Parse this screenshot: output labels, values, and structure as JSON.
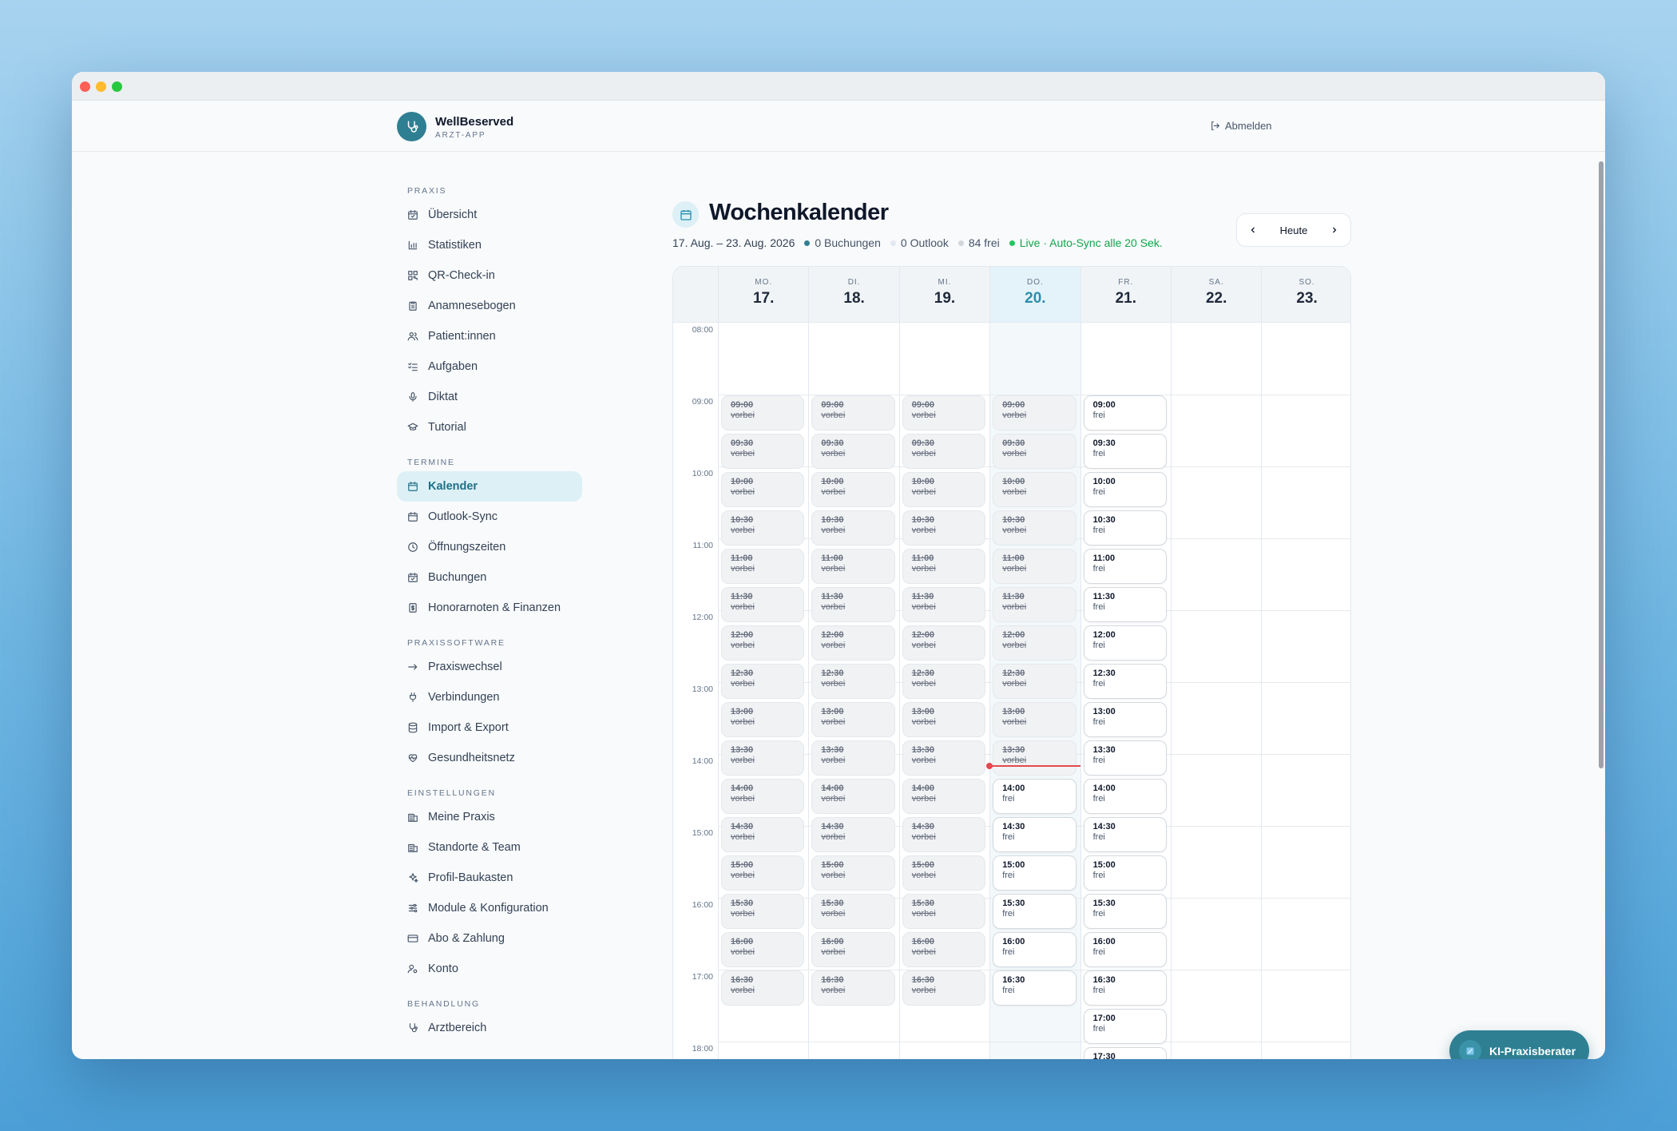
{
  "app": {
    "name": "WellBeserved",
    "subtitle": "ARZT-APP",
    "logout": "Abmelden"
  },
  "sidebar": {
    "sections": [
      {
        "label": "PRAXIS",
        "items": [
          {
            "label": "Übersicht",
            "icon": "calendar-check-icon"
          },
          {
            "label": "Statistiken",
            "icon": "bar-chart-icon"
          },
          {
            "label": "QR-Check-in",
            "icon": "qr-code-icon"
          },
          {
            "label": "Anamnesebogen",
            "icon": "clipboard-icon"
          },
          {
            "label": "Patient:innen",
            "icon": "users-icon"
          },
          {
            "label": "Aufgaben",
            "icon": "checklist-icon"
          },
          {
            "label": "Diktat",
            "icon": "microphone-icon"
          },
          {
            "label": "Tutorial",
            "icon": "graduation-cap-icon"
          }
        ]
      },
      {
        "label": "TERMINE",
        "items": [
          {
            "label": "Kalender",
            "icon": "calendar-icon",
            "active": true
          },
          {
            "label": "Outlook-Sync",
            "icon": "calendar-icon"
          },
          {
            "label": "Öffnungszeiten",
            "icon": "clock-icon"
          },
          {
            "label": "Buchungen",
            "icon": "calendar-check-icon"
          },
          {
            "label": "Honorarnoten & Finanzen",
            "icon": "invoice-icon"
          }
        ]
      },
      {
        "label": "PRAXISSOFTWARE",
        "items": [
          {
            "label": "Praxiswechsel",
            "icon": "arrow-right-icon"
          },
          {
            "label": "Verbindungen",
            "icon": "plug-icon"
          },
          {
            "label": "Import & Export",
            "icon": "database-icon"
          },
          {
            "label": "Gesundheitsnetz",
            "icon": "heart-pulse-icon"
          }
        ]
      },
      {
        "label": "EINSTELLUNGEN",
        "items": [
          {
            "label": "Meine Praxis",
            "icon": "building-icon"
          },
          {
            "label": "Standorte & Team",
            "icon": "building-icon"
          },
          {
            "label": "Profil-Baukasten",
            "icon": "sparkles-icon"
          },
          {
            "label": "Module & Konfiguration",
            "icon": "sliders-icon"
          },
          {
            "label": "Abo & Zahlung",
            "icon": "credit-card-icon"
          },
          {
            "label": "Konto",
            "icon": "user-cog-icon"
          }
        ]
      },
      {
        "label": "BEHANDLUNG",
        "items": [
          {
            "label": "Arztbereich",
            "icon": "stethoscope-icon"
          }
        ]
      }
    ]
  },
  "calendar": {
    "title": "Wochenkalender",
    "range": "17. Aug. – 23. Aug. 2026",
    "stats": {
      "bookings": "0 Buchungen",
      "outlook": "0 Outlook",
      "free": "84 frei",
      "live": "Live · Auto-Sync alle 20 Sek."
    },
    "colors": {
      "bookings": "#2f7f93",
      "outlook": "#e2e8f0",
      "free": "#e5e7eb",
      "live": "#16a34a",
      "now": "#e5484d"
    },
    "today_label": "Heute",
    "days": [
      {
        "wd": "MO.",
        "dn": "17."
      },
      {
        "wd": "DI.",
        "dn": "18."
      },
      {
        "wd": "MI.",
        "dn": "19."
      },
      {
        "wd": "DO.",
        "dn": "20.",
        "today": true
      },
      {
        "wd": "FR.",
        "dn": "21."
      },
      {
        "wd": "SA.",
        "dn": "22."
      },
      {
        "wd": "SO.",
        "dn": "23."
      }
    ],
    "hours": [
      "08:00",
      "09:00",
      "10:00",
      "11:00",
      "12:00",
      "13:00",
      "14:00",
      "15:00",
      "16:00",
      "17:00",
      "18:00"
    ],
    "slot_times": [
      "09:00",
      "09:30",
      "10:00",
      "10:30",
      "11:00",
      "11:30",
      "12:00",
      "12:30",
      "13:00",
      "13:30",
      "14:00",
      "14:30",
      "15:00",
      "15:30",
      "16:00",
      "16:30",
      "17:00",
      "17:30"
    ],
    "status_past": "vorbei",
    "status_free": "frei",
    "day_slots": [
      {
        "past": 16,
        "total": 16
      },
      {
        "past": 16,
        "total": 16
      },
      {
        "past": 16,
        "total": 16
      },
      {
        "past": 10,
        "total": 16
      },
      {
        "past": 0,
        "total": 18
      },
      {
        "past": 0,
        "total": 0
      },
      {
        "past": 0,
        "total": 0
      }
    ],
    "now_time": "14:10"
  },
  "assistant": {
    "label": "KI-Praxisberater"
  }
}
